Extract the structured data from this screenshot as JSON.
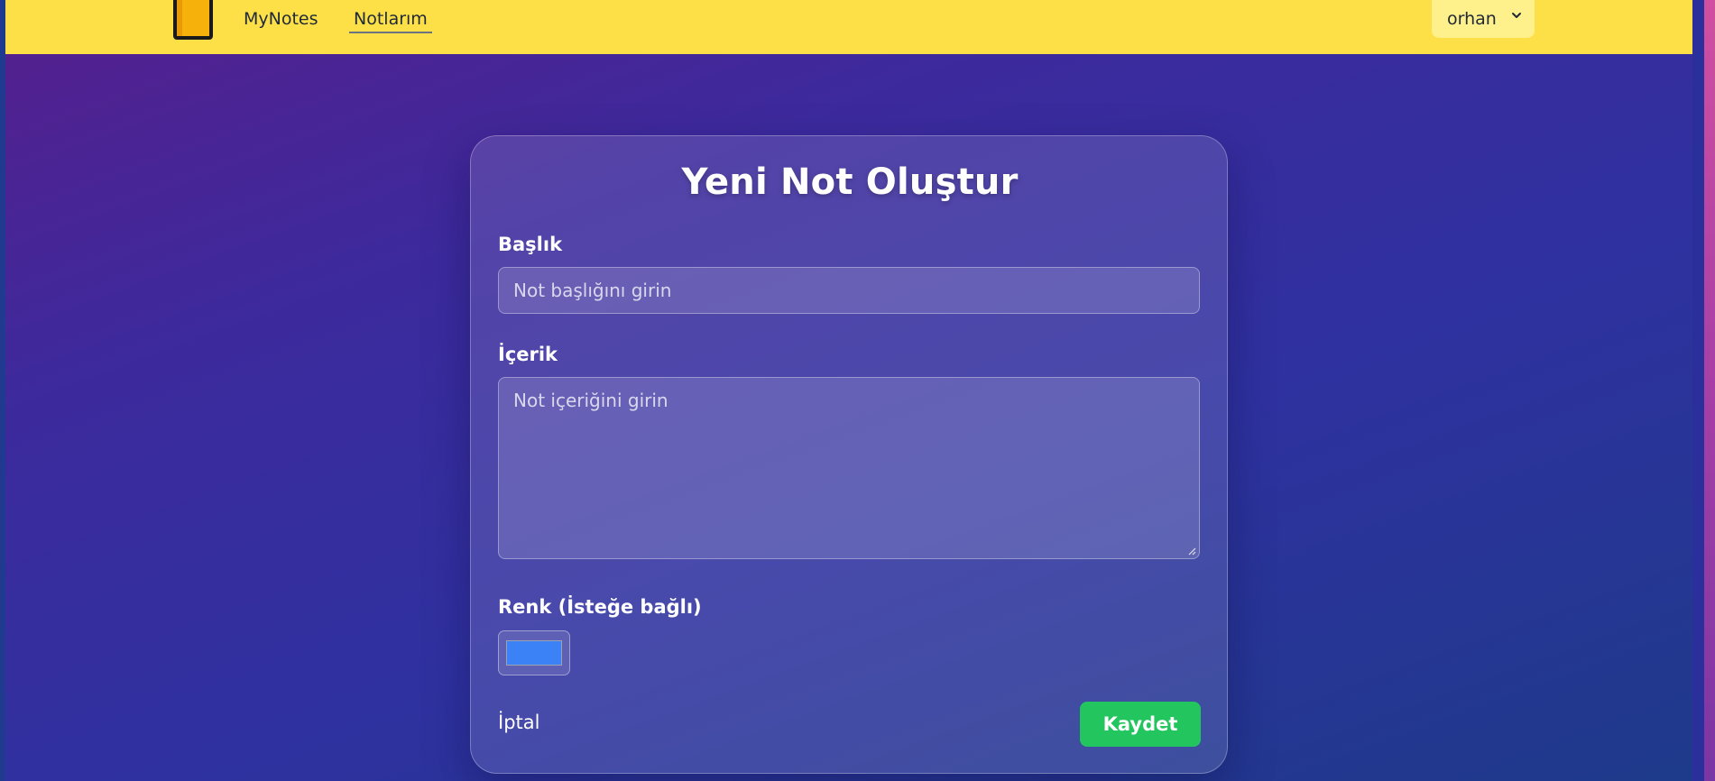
{
  "navbar": {
    "brand_label": "MyNotes",
    "notes_link_label": "Notlarım",
    "user_menu_label": "orhan",
    "user_menu_icon": "chevron-down-icon"
  },
  "form": {
    "heading": "Yeni Not Oluştur",
    "title_label": "Başlık",
    "title_placeholder": "Not başlığını girin",
    "title_value": "",
    "content_label": "İçerik",
    "content_placeholder": "Not içeriğini girin",
    "content_value": "",
    "color_label": "Renk (İsteğe bağlı)",
    "color_value": "#3b82f6",
    "cancel_label": "İptal",
    "save_label": "Kaydet"
  },
  "colors": {
    "navbar_bg": "#fde047",
    "save_button": "#22c55e",
    "background_from": "#561f8d",
    "background_to": "#1e3a8a"
  }
}
